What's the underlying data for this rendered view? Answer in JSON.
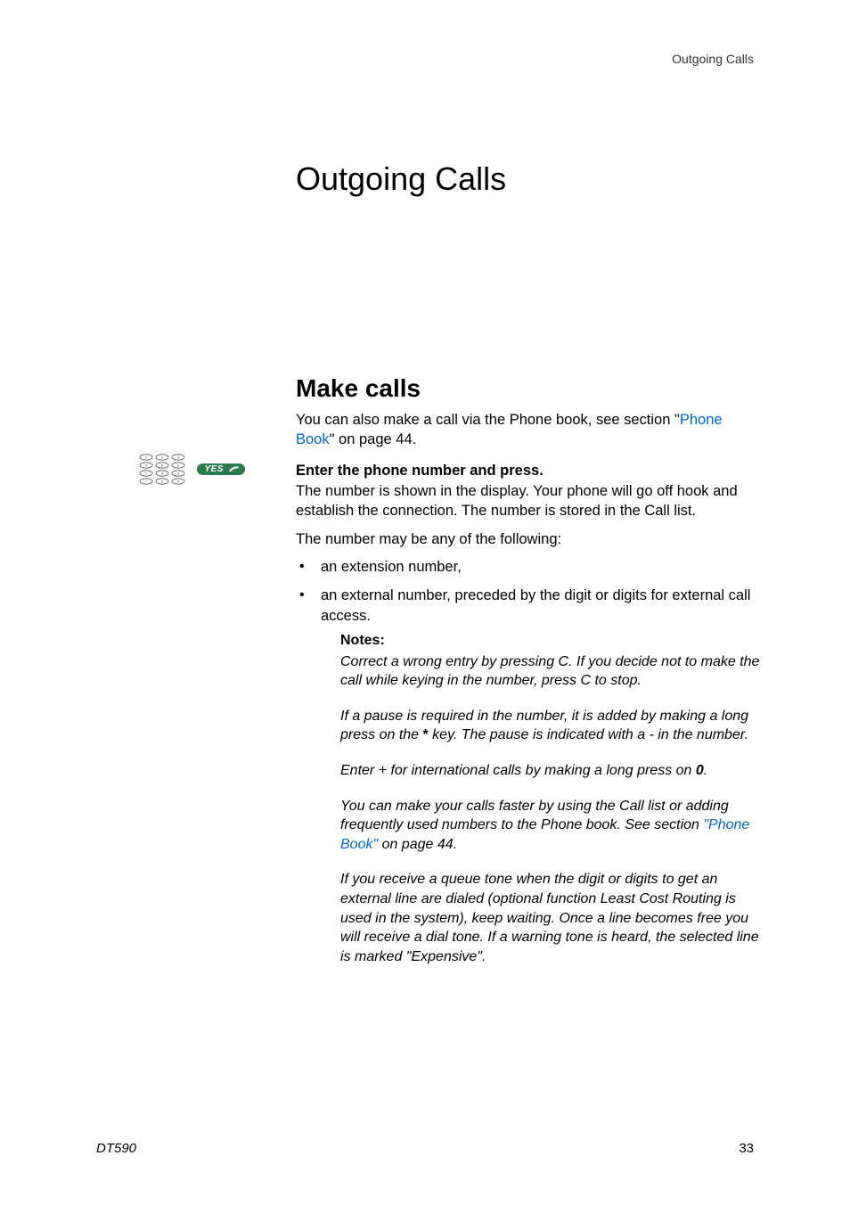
{
  "running_header": "Outgoing Calls",
  "page_title": "Outgoing Calls",
  "section_title": "Make calls",
  "intro": {
    "pre": "You can also make a call via the Phone book, see section \"",
    "link": "Phone Book",
    "post": "\" on page 44."
  },
  "icons": {
    "keypad_name": "keypad-icon",
    "yes_label": "YES",
    "yes_name": "yes-button-icon"
  },
  "instruction": {
    "heading": "Enter the phone number and press.",
    "body": "The number is shown in the display. Your phone will go off hook and establish the connection. The number is stored in the Call list."
  },
  "follow": "The number may be any of the following:",
  "bullets": [
    "an extension number,",
    "an external number, preceded by the digit or digits for external call access."
  ],
  "notes": {
    "heading": "Notes:",
    "p1": "Correct a wrong entry by pressing C. If you decide not to make the call while keying in the number, press C to stop.",
    "p2a": "If a pause is required in the number, it is added by making a long press on the ",
    "p2star": "*",
    "p2b": " key. The pause is indicated with a - in the number.",
    "p3a": "Enter + for international calls by making a long press on ",
    "p3zero": "0",
    "p3b": ".",
    "p4a": "You can make your calls faster by using the Call list or adding frequently used numbers to the Phone book. See section ",
    "p4link": "\"Phone Book\"",
    "p4b": " on page 44",
    "p4c": ".",
    "p5": "If you receive a queue tone when the digit or digits to get an external line are dialed (optional function Least Cost Routing is used in the system), keep waiting. Once a line becomes free you will receive a dial tone. If a warning tone is heard, the selected line is marked \"Expensive\"."
  },
  "footer": {
    "model": "DT590",
    "page": "33"
  }
}
